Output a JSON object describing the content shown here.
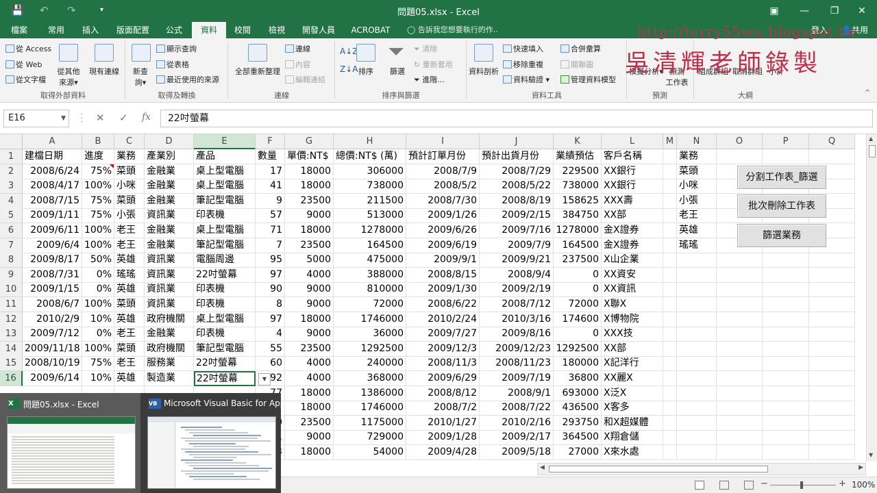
{
  "window": {
    "title": "問題05.xlsx - Excel",
    "save_icon": "save-icon",
    "undo_icon": "undo-icon",
    "redo_icon": "redo-icon",
    "qa_more": "▾",
    "ribbon_display_icon": "ribbon-display-icon",
    "minimize": "—",
    "maximize": "❐",
    "close": "✕"
  },
  "tabs": {
    "items": [
      "檔案",
      "常用",
      "插入",
      "版面配置",
      "公式",
      "資料",
      "校閱",
      "檢視",
      "開發人員",
      "ACROBAT"
    ],
    "active": "資料",
    "tell_me": "告訴我您想要執行的作..",
    "login": "登入",
    "share": "共用"
  },
  "watermark": {
    "url": "http://terry55wu.blogspot.tw",
    "author": "吳清輝老師錄製"
  },
  "ribbon": {
    "get_external": {
      "from_access": "從 Access",
      "from_web": "從 Web",
      "from_text": "從文字檔",
      "other_sources": "從其他",
      "other_sources2": "來源▾",
      "existing": "現有連線",
      "label": "取得外部資料"
    },
    "get_transform": {
      "new_query": "新查",
      "new_query2": "詢▾",
      "show_queries": "顯示查詢",
      "from_table": "從表格",
      "recent_sources": "最近使用的來源",
      "label": "取得及轉換"
    },
    "connections": {
      "refresh_all": "全部重新整理",
      "connections": "連線",
      "properties": "內容",
      "edit_links": "編輯連結",
      "label": "連線"
    },
    "sort_filter": {
      "sort": "排序",
      "filter": "篩選",
      "clear": "清除",
      "reapply": "重新套用",
      "advanced": "進階...",
      "label": "排序與篩選"
    },
    "data_tools": {
      "text_to_columns": "資料剖析",
      "flash_fill": "快速填入",
      "remove_duplicates": "移除重複",
      "validation": "資料驗證",
      "consolidate": "合併彙算",
      "relationships": "關聯圖",
      "manage_model": "管理資料模型",
      "label": "資料工具"
    },
    "forecast": {
      "what_if": "模擬分析",
      "forecast_sheet": "預測",
      "forecast_sheet2": "工作表",
      "label": "預測"
    },
    "outline": {
      "group": "組成群組",
      "ungroup": "取消群組",
      "subtotal": "小計",
      "label": "大綱"
    }
  },
  "formula_bar": {
    "name_box": "E16",
    "cancel": "✕",
    "enter": "✓",
    "fx": "fx",
    "value": "22吋螢幕"
  },
  "grid": {
    "columns": [
      "A",
      "B",
      "C",
      "D",
      "E",
      "F",
      "G",
      "H",
      "I",
      "J",
      "K",
      "L",
      "M",
      "N",
      "O",
      "P",
      "Q"
    ],
    "header_row": [
      "建檔日期",
      "進度",
      "業務",
      "產業別",
      "產品",
      "數量",
      "單價:NT$",
      "總價:NT$ (萬)",
      "預計訂單月份",
      "預計出貨月份",
      "業績預估",
      "客戶名稱",
      "",
      "業務"
    ],
    "rows": [
      [
        "2008/6/24",
        "75%",
        "菜頭",
        "金融業",
        "桌上型電腦",
        "17",
        "18000",
        "306000",
        "2008/7/9",
        "2008/7/29",
        "229500",
        "XX銀行",
        "",
        "菜頭"
      ],
      [
        "2008/4/17",
        "100%",
        "小咪",
        "金融業",
        "桌上型電腦",
        "41",
        "18000",
        "738000",
        "2008/5/2",
        "2008/5/22",
        "738000",
        "XX銀行",
        "",
        "小咪"
      ],
      [
        "2008/7/15",
        "75%",
        "菜頭",
        "金融業",
        "筆記型電腦",
        "9",
        "23500",
        "211500",
        "2008/7/30",
        "2008/8/19",
        "158625",
        "XXX壽",
        "",
        "小張"
      ],
      [
        "2009/1/11",
        "75%",
        "小張",
        "資訊業",
        "印表機",
        "57",
        "9000",
        "513000",
        "2009/1/26",
        "2009/2/15",
        "384750",
        "XX部",
        "",
        "老王"
      ],
      [
        "2009/6/11",
        "100%",
        "老王",
        "金融業",
        "桌上型電腦",
        "71",
        "18000",
        "1278000",
        "2009/6/26",
        "2009/7/16",
        "1278000",
        "金X證券",
        "",
        "英雄"
      ],
      [
        "2009/6/4",
        "100%",
        "老王",
        "金融業",
        "筆記型電腦",
        "7",
        "23500",
        "164500",
        "2009/6/19",
        "2009/7/9",
        "164500",
        "金X證券",
        "",
        "瑤瑤"
      ],
      [
        "2009/8/17",
        "50%",
        "英雄",
        "資訊業",
        "電腦周邊",
        "95",
        "5000",
        "475000",
        "2009/9/1",
        "2009/9/21",
        "237500",
        "X山企業",
        "",
        ""
      ],
      [
        "2008/7/31",
        "0%",
        "瑤瑤",
        "資訊業",
        "22吋螢幕",
        "97",
        "4000",
        "388000",
        "2008/8/15",
        "2008/9/4",
        "0",
        "XX資安",
        "",
        ""
      ],
      [
        "2009/1/15",
        "0%",
        "英雄",
        "資訊業",
        "印表機",
        "90",
        "9000",
        "810000",
        "2009/1/30",
        "2009/2/19",
        "0",
        "XX資訊",
        "",
        ""
      ],
      [
        "2008/6/7",
        "100%",
        "菜頭",
        "資訊業",
        "印表機",
        "8",
        "9000",
        "72000",
        "2008/6/22",
        "2008/7/12",
        "72000",
        "X聯X",
        "",
        ""
      ],
      [
        "2010/2/9",
        "10%",
        "英雄",
        "政府機關",
        "桌上型電腦",
        "97",
        "18000",
        "1746000",
        "2010/2/24",
        "2010/3/16",
        "174600",
        "X博物院",
        "",
        ""
      ],
      [
        "2009/7/12",
        "0%",
        "老王",
        "金融業",
        "印表機",
        "4",
        "9000",
        "36000",
        "2009/7/27",
        "2009/8/16",
        "0",
        "XXX技",
        "",
        ""
      ],
      [
        "2009/11/18",
        "100%",
        "菜頭",
        "政府機關",
        "筆記型電腦",
        "55",
        "23500",
        "1292500",
        "2009/12/3",
        "2009/12/23",
        "1292500",
        "XX部",
        "",
        ""
      ],
      [
        "2008/10/19",
        "75%",
        "老王",
        "服務業",
        "22吋螢幕",
        "60",
        "4000",
        "240000",
        "2008/11/3",
        "2008/11/23",
        "180000",
        "X記洋行",
        "",
        ""
      ],
      [
        "2009/6/14",
        "10%",
        "英雄",
        "製造業",
        "22吋螢幕",
        "92",
        "4000",
        "368000",
        "2009/6/29",
        "2009/7/19",
        "36800",
        "XX麗X",
        "",
        ""
      ],
      [
        "",
        "",
        "",
        "",
        "",
        "77",
        "18000",
        "1386000",
        "2008/8/12",
        "2008/9/1",
        "693000",
        "X泛X",
        "",
        ""
      ],
      [
        "",
        "",
        "",
        "",
        "",
        "97",
        "18000",
        "1746000",
        "2008/7/2",
        "2008/7/22",
        "436500",
        "X客多",
        "",
        ""
      ],
      [
        "",
        "",
        "",
        "",
        "",
        "50",
        "23500",
        "1175000",
        "2010/1/27",
        "2010/2/16",
        "293750",
        "和X超媒體",
        "",
        ""
      ],
      [
        "",
        "",
        "",
        "",
        "",
        "81",
        "9000",
        "729000",
        "2009/1/28",
        "2009/2/17",
        "364500",
        "X翔倉儲",
        "",
        ""
      ],
      [
        "",
        "",
        "",
        "",
        "",
        "3",
        "18000",
        "54000",
        "2009/4/28",
        "2009/5/18",
        "27000",
        "X來水處",
        "",
        ""
      ]
    ],
    "row_numbers": [
      "1",
      "2",
      "3",
      "4",
      "5",
      "6",
      "7",
      "8",
      "9",
      "10",
      "11",
      "12",
      "13",
      "14",
      "15",
      "16"
    ],
    "buttons": [
      "分割工作表_篩選",
      "批次刪除工作表",
      "篩選業務"
    ]
  },
  "status_bar": {
    "zoom": "100%",
    "zoom_out": "−",
    "zoom_in": "+"
  },
  "taskbar_preview": {
    "items": [
      {
        "badge": "X",
        "label": "問題05.xlsx - Excel"
      },
      {
        "badge": "VB",
        "label": "Microsoft Visual Basic for App..."
      }
    ]
  }
}
